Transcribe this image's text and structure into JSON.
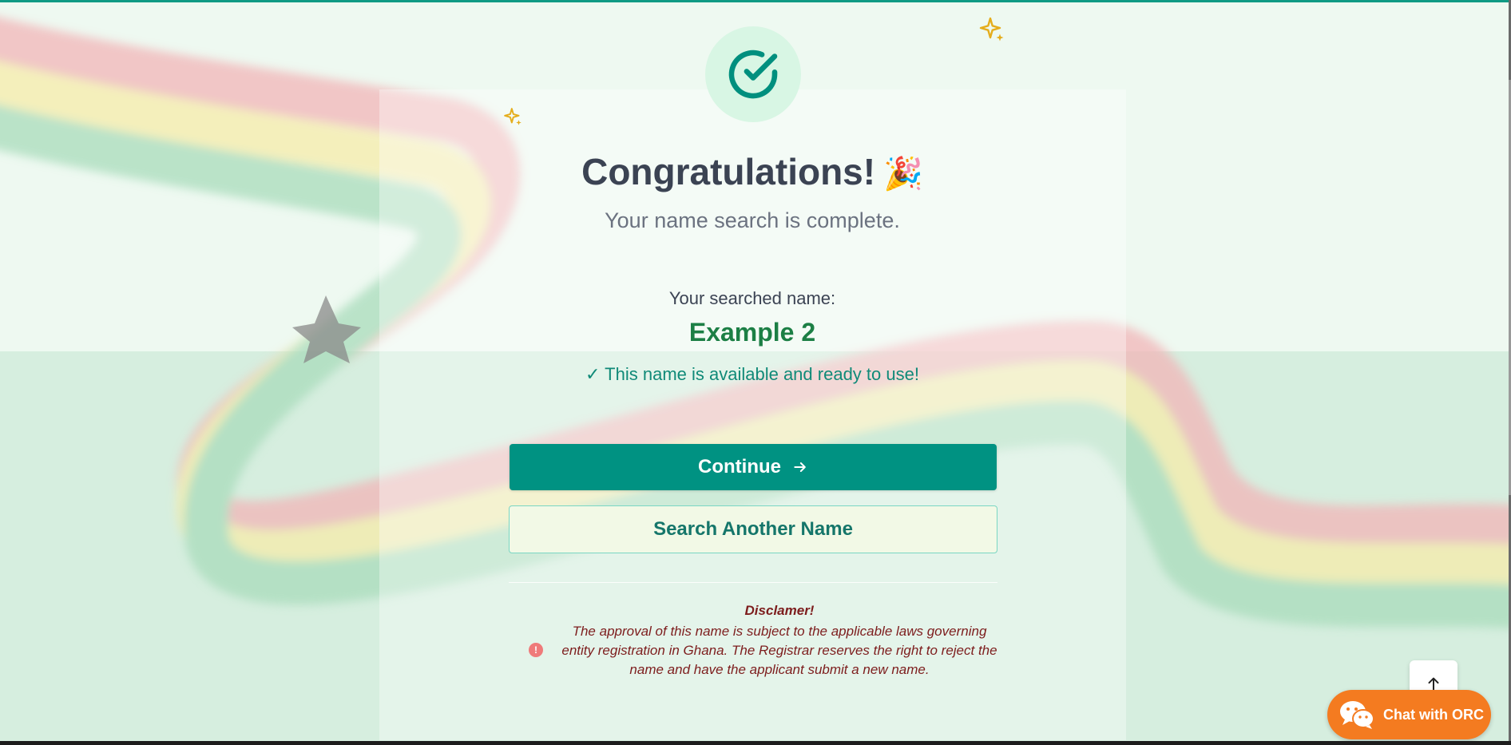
{
  "header": {
    "title": "Congratulations!",
    "title_emoji": "🎉",
    "subtitle": "Your name search is complete."
  },
  "result": {
    "searched_label": "Your searched name:",
    "searched_name": "Example 2",
    "availability": "✓ This name is available and ready to use!"
  },
  "actions": {
    "continue_label": "Continue",
    "search_another_label": "Search Another Name"
  },
  "disclaimer": {
    "title": "Disclamer!",
    "body": "The approval of this name is subject to the applicable laws governing entity registration in Ghana. The Registrar reserves the right to reject the name and have the applicant submit a new name."
  },
  "chat": {
    "label": "Chat with ORC"
  },
  "icons": {
    "success": "check-circle-icon",
    "sparkles": "sparkles-icon",
    "continue_arrow": "arrow-right-icon",
    "scroll_top": "arrow-up-icon",
    "disclaimer": "alert-icon",
    "chat": "wechat-icon"
  },
  "colors": {
    "primary": "#009282",
    "success_text": "#1c7f45",
    "available_text": "#108a78",
    "disclaimer_text": "#7d1d1d",
    "chat_button": "#f47b20"
  }
}
